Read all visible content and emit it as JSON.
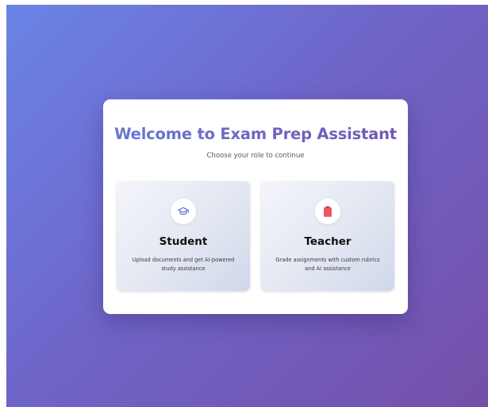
{
  "welcome": {
    "title": "Welcome to Exam Prep Assistant",
    "subtitle": "Choose your role to continue"
  },
  "roles": [
    {
      "title": "Student",
      "description": "Upload documents and get AI-powered study assistance",
      "icon": "graduation-cap-icon",
      "icon_color": "#6a78d6"
    },
    {
      "title": "Teacher",
      "description": "Grade assignments with custom rubrics and AI assistance",
      "icon": "clipboard-icon",
      "icon_color": "#ee5560"
    }
  ],
  "colors": {
    "background_start": "#6a85e6",
    "background_end": "#744fa8",
    "title_accent": "#6a60c4"
  }
}
